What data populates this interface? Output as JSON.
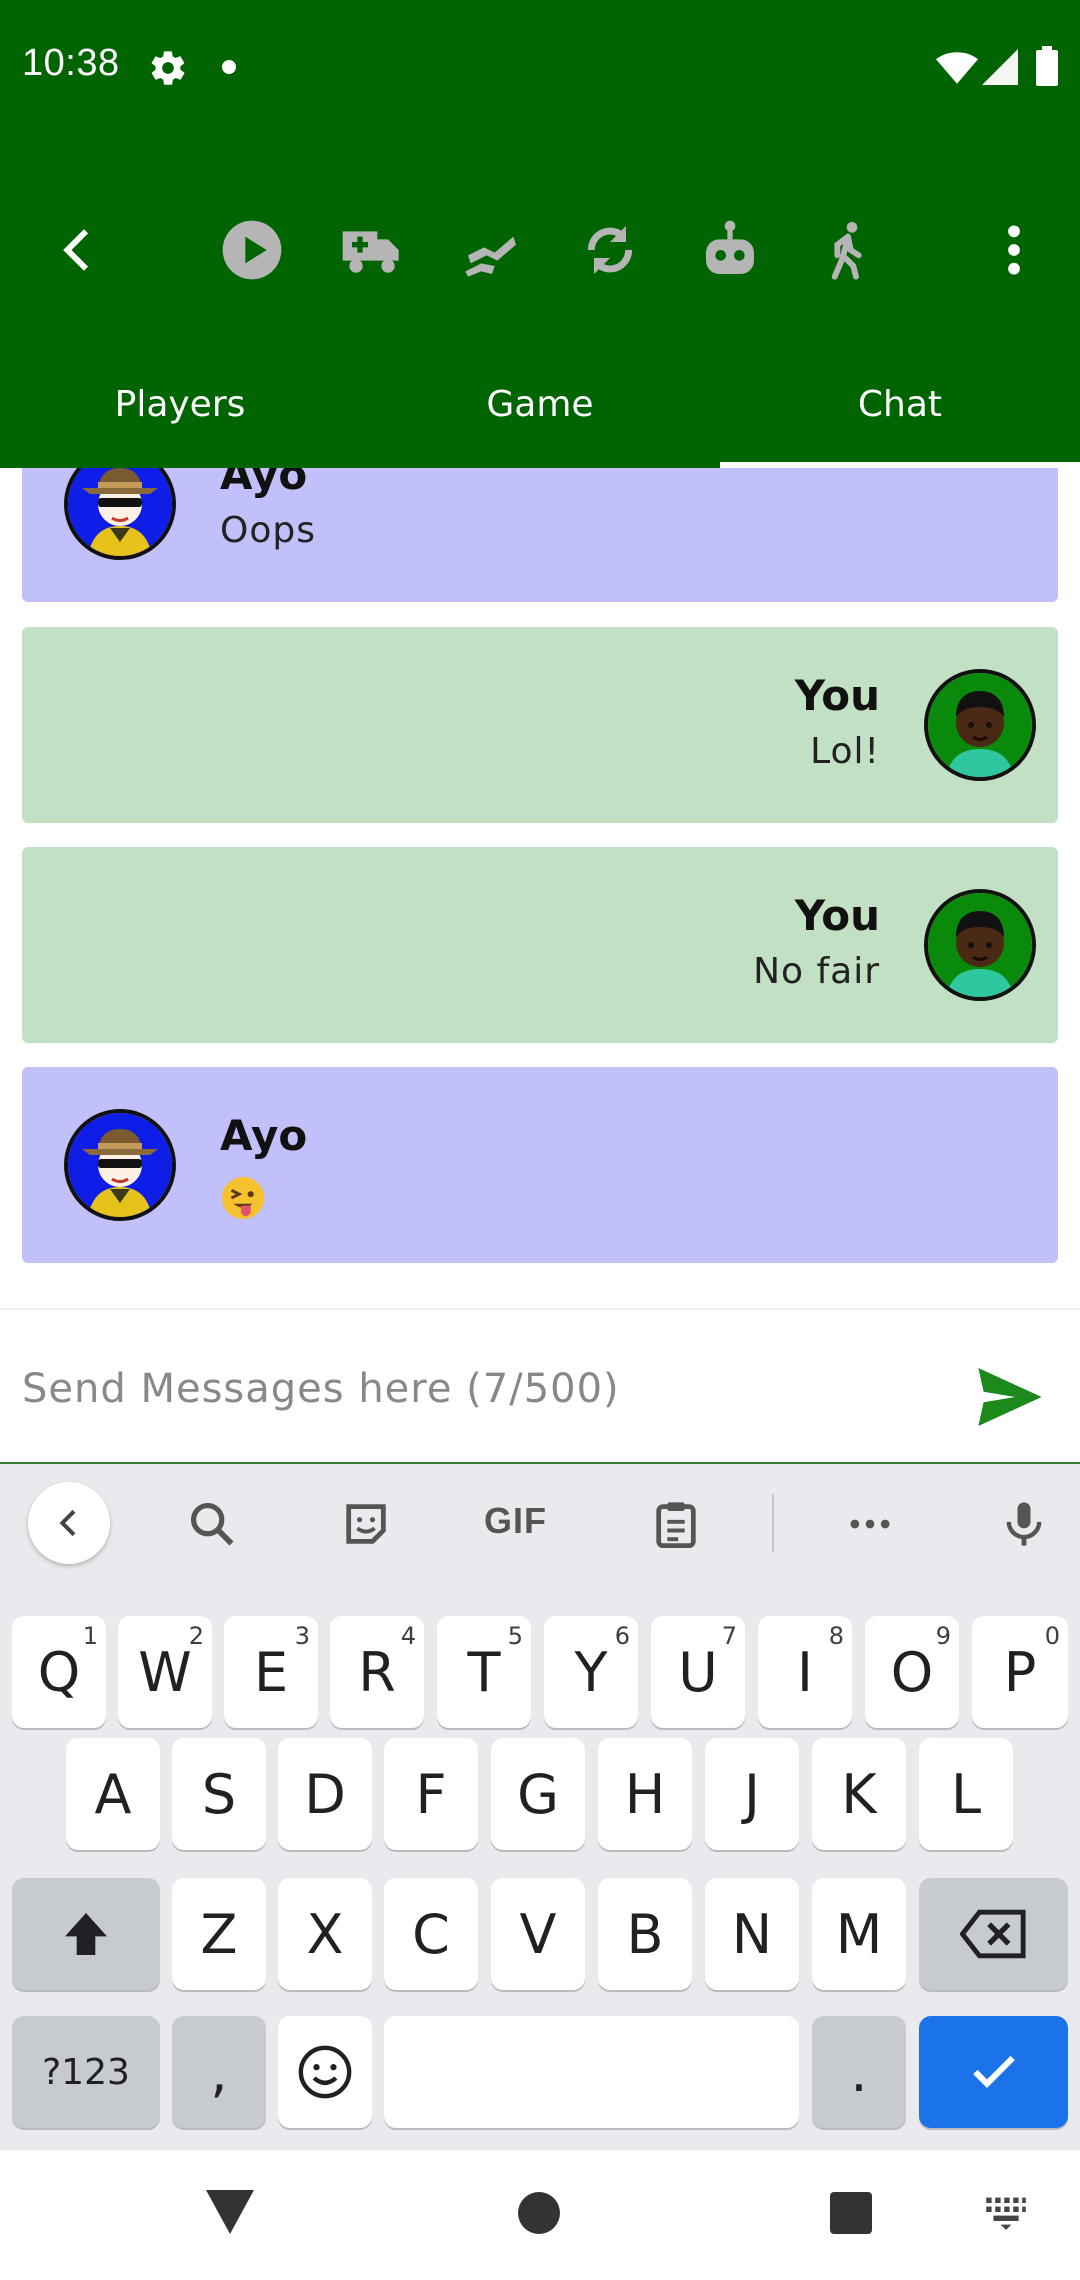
{
  "status_bar": {
    "time": "10:38",
    "icons": [
      "settings-gear-icon",
      "notification-dot-icon",
      "wifi-icon",
      "cell-signal-icon",
      "battery-icon"
    ]
  },
  "toolbar": {
    "icons": [
      "back-chevron-icon",
      "play-icon",
      "ambulance-icon",
      "swap-players-icon",
      "refresh-icon",
      "robot-icon",
      "walk-icon",
      "overflow-menu-icon"
    ]
  },
  "tabs": [
    {
      "label": "Players",
      "selected": false
    },
    {
      "label": "Game",
      "selected": false
    },
    {
      "label": "Chat",
      "selected": true
    }
  ],
  "messages": [
    {
      "sender": "Ayo",
      "text": "Oops",
      "self": false
    },
    {
      "sender": "You",
      "text": "Lol!",
      "self": true
    },
    {
      "sender": "You",
      "text": "No fair",
      "self": true
    },
    {
      "sender": "Ayo",
      "emoji": "winking-tongue-face-emoji",
      "self": false
    }
  ],
  "input": {
    "placeholder": "Send Messages here (7/500)",
    "value": ""
  },
  "keyboard": {
    "suggestion_strip": {
      "gif_label": "GIF",
      "icons": [
        "collapse-chevron-icon",
        "search-icon",
        "sticker-icon",
        "gif-icon",
        "clipboard-icon",
        "more-dots-icon",
        "microphone-icon"
      ]
    },
    "row1": [
      {
        "key": "Q",
        "sup": "1"
      },
      {
        "key": "W",
        "sup": "2"
      },
      {
        "key": "E",
        "sup": "3"
      },
      {
        "key": "R",
        "sup": "4"
      },
      {
        "key": "T",
        "sup": "5"
      },
      {
        "key": "Y",
        "sup": "6"
      },
      {
        "key": "U",
        "sup": "7"
      },
      {
        "key": "I",
        "sup": "8"
      },
      {
        "key": "O",
        "sup": "9"
      },
      {
        "key": "P",
        "sup": "0"
      }
    ],
    "row2": [
      "A",
      "S",
      "D",
      "F",
      "G",
      "H",
      "J",
      "K",
      "L"
    ],
    "row3": [
      "Z",
      "X",
      "C",
      "V",
      "B",
      "N",
      "M"
    ],
    "row4": {
      "symbols": "?123",
      "comma": ",",
      "period": "."
    }
  },
  "colors": {
    "header_green": "#006400",
    "other_bubble": "#c2c0fa",
    "self_bubble": "#c2e0c3",
    "send_green": "#1b8a1b",
    "enter_blue": "#1a73e8"
  }
}
